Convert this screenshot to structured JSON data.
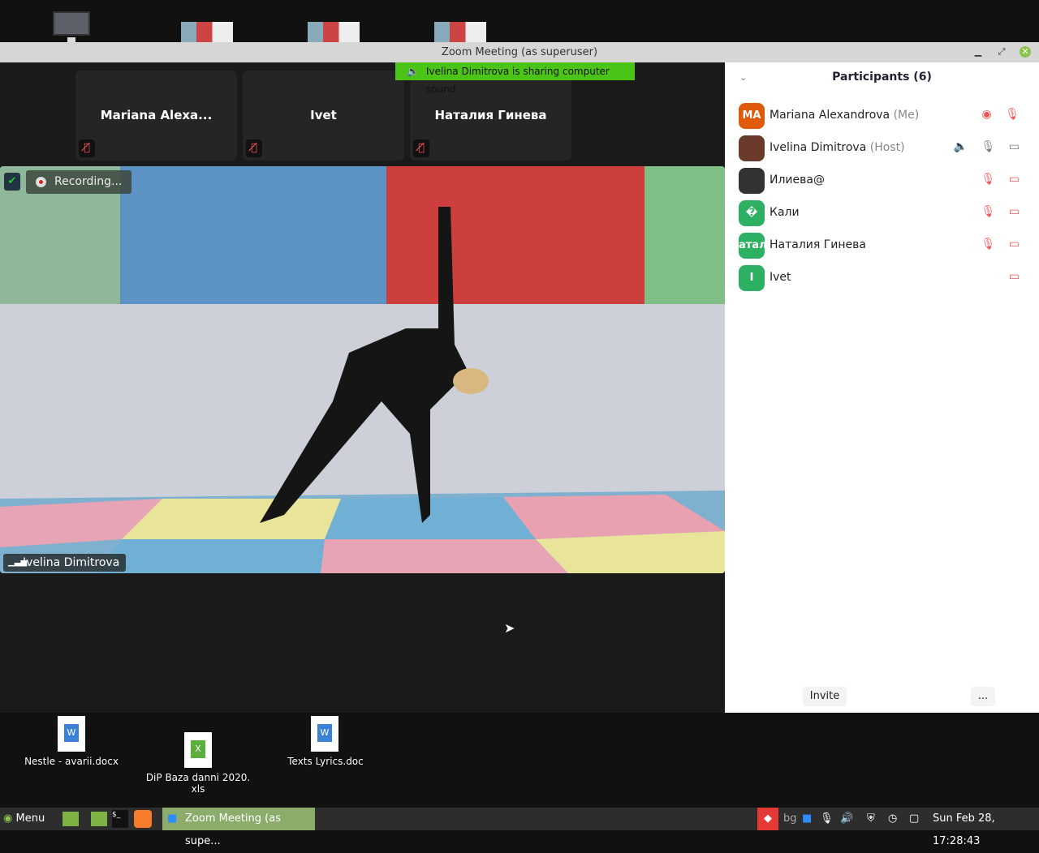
{
  "window": {
    "title": "Zoom Meeting (as superuser)"
  },
  "banner": {
    "text": "Ivelina Dimitrova is sharing computer sound"
  },
  "tiles": [
    {
      "name": "Mariana Alexa..."
    },
    {
      "name": "Ivet"
    },
    {
      "name": "Наталия Гинева"
    }
  ],
  "video": {
    "recording": "Recording...",
    "speaker": "Ivelina Dimitrova"
  },
  "participants": {
    "title": "Participants (6)",
    "items": [
      {
        "initials": "MA",
        "name": "Mariana Alexandrova",
        "role": "(Me)",
        "color": "#e05a0c",
        "icons": "◉ 🎙"
      },
      {
        "initials": "",
        "name": "Ivelina Dimitrova",
        "role": "(Host)",
        "color": "#6a3b2a",
        "icons": "🔈 🎙 ▭"
      },
      {
        "initials": "",
        "name": "Илиева@",
        "role": "",
        "color": "#333",
        "icons": "🎙 ▭"
      },
      {
        "initials": "�",
        "name": "Кали",
        "role": "",
        "color": "#2eb062",
        "icons": "🎙 ▭"
      },
      {
        "initials": "атал",
        "name": "Наталия Гинева",
        "role": "",
        "color": "#2eb062",
        "icons": "🎙 ▭"
      },
      {
        "initials": "I",
        "name": "Ivet",
        "role": "",
        "color": "#2eb062",
        "icons": "▭"
      }
    ],
    "invite": "Invite",
    "more": "..."
  },
  "desktop": [
    {
      "label": "Nestle - avarii.docx",
      "type": "W"
    },
    {
      "label": "DiP Baza danni  2020.\nxls",
      "type": "X"
    },
    {
      "label": "Texts Lyrics.doc",
      "type": "W"
    }
  ],
  "taskbar": {
    "menu": "Menu",
    "window": "Zoom Meeting (as supe...",
    "lang": "bg",
    "clock": "Sun Feb 28, 17:28:43"
  }
}
